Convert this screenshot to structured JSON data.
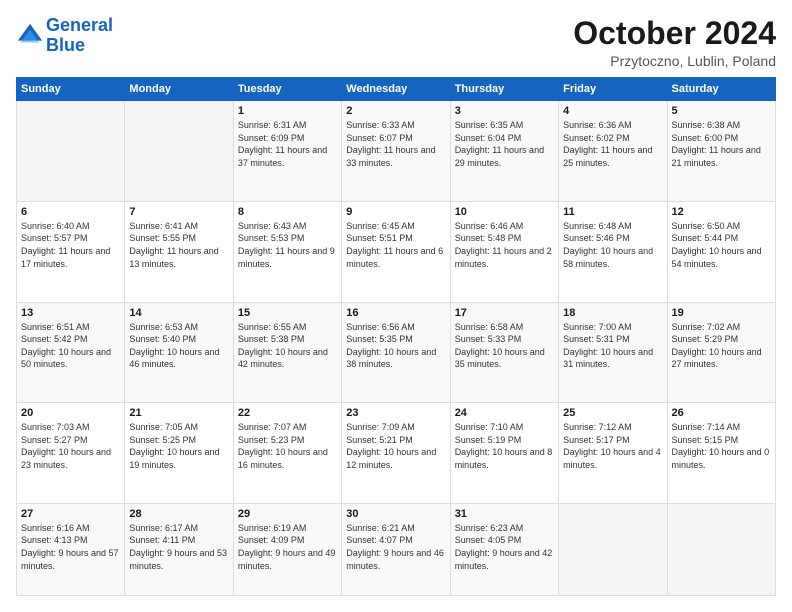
{
  "logo": {
    "line1": "General",
    "line2": "Blue"
  },
  "header": {
    "month": "October 2024",
    "location": "Przytoczno, Lublin, Poland"
  },
  "weekdays": [
    "Sunday",
    "Monday",
    "Tuesday",
    "Wednesday",
    "Thursday",
    "Friday",
    "Saturday"
  ],
  "weeks": [
    [
      {
        "day": "",
        "sunrise": "",
        "sunset": "",
        "daylight": ""
      },
      {
        "day": "",
        "sunrise": "",
        "sunset": "",
        "daylight": ""
      },
      {
        "day": "1",
        "sunrise": "Sunrise: 6:31 AM",
        "sunset": "Sunset: 6:09 PM",
        "daylight": "Daylight: 11 hours and 37 minutes."
      },
      {
        "day": "2",
        "sunrise": "Sunrise: 6:33 AM",
        "sunset": "Sunset: 6:07 PM",
        "daylight": "Daylight: 11 hours and 33 minutes."
      },
      {
        "day": "3",
        "sunrise": "Sunrise: 6:35 AM",
        "sunset": "Sunset: 6:04 PM",
        "daylight": "Daylight: 11 hours and 29 minutes."
      },
      {
        "day": "4",
        "sunrise": "Sunrise: 6:36 AM",
        "sunset": "Sunset: 6:02 PM",
        "daylight": "Daylight: 11 hours and 25 minutes."
      },
      {
        "day": "5",
        "sunrise": "Sunrise: 6:38 AM",
        "sunset": "Sunset: 6:00 PM",
        "daylight": "Daylight: 11 hours and 21 minutes."
      }
    ],
    [
      {
        "day": "6",
        "sunrise": "Sunrise: 6:40 AM",
        "sunset": "Sunset: 5:57 PM",
        "daylight": "Daylight: 11 hours and 17 minutes."
      },
      {
        "day": "7",
        "sunrise": "Sunrise: 6:41 AM",
        "sunset": "Sunset: 5:55 PM",
        "daylight": "Daylight: 11 hours and 13 minutes."
      },
      {
        "day": "8",
        "sunrise": "Sunrise: 6:43 AM",
        "sunset": "Sunset: 5:53 PM",
        "daylight": "Daylight: 11 hours and 9 minutes."
      },
      {
        "day": "9",
        "sunrise": "Sunrise: 6:45 AM",
        "sunset": "Sunset: 5:51 PM",
        "daylight": "Daylight: 11 hours and 6 minutes."
      },
      {
        "day": "10",
        "sunrise": "Sunrise: 6:46 AM",
        "sunset": "Sunset: 5:48 PM",
        "daylight": "Daylight: 11 hours and 2 minutes."
      },
      {
        "day": "11",
        "sunrise": "Sunrise: 6:48 AM",
        "sunset": "Sunset: 5:46 PM",
        "daylight": "Daylight: 10 hours and 58 minutes."
      },
      {
        "day": "12",
        "sunrise": "Sunrise: 6:50 AM",
        "sunset": "Sunset: 5:44 PM",
        "daylight": "Daylight: 10 hours and 54 minutes."
      }
    ],
    [
      {
        "day": "13",
        "sunrise": "Sunrise: 6:51 AM",
        "sunset": "Sunset: 5:42 PM",
        "daylight": "Daylight: 10 hours and 50 minutes."
      },
      {
        "day": "14",
        "sunrise": "Sunrise: 6:53 AM",
        "sunset": "Sunset: 5:40 PM",
        "daylight": "Daylight: 10 hours and 46 minutes."
      },
      {
        "day": "15",
        "sunrise": "Sunrise: 6:55 AM",
        "sunset": "Sunset: 5:38 PM",
        "daylight": "Daylight: 10 hours and 42 minutes."
      },
      {
        "day": "16",
        "sunrise": "Sunrise: 6:56 AM",
        "sunset": "Sunset: 5:35 PM",
        "daylight": "Daylight: 10 hours and 38 minutes."
      },
      {
        "day": "17",
        "sunrise": "Sunrise: 6:58 AM",
        "sunset": "Sunset: 5:33 PM",
        "daylight": "Daylight: 10 hours and 35 minutes."
      },
      {
        "day": "18",
        "sunrise": "Sunrise: 7:00 AM",
        "sunset": "Sunset: 5:31 PM",
        "daylight": "Daylight: 10 hours and 31 minutes."
      },
      {
        "day": "19",
        "sunrise": "Sunrise: 7:02 AM",
        "sunset": "Sunset: 5:29 PM",
        "daylight": "Daylight: 10 hours and 27 minutes."
      }
    ],
    [
      {
        "day": "20",
        "sunrise": "Sunrise: 7:03 AM",
        "sunset": "Sunset: 5:27 PM",
        "daylight": "Daylight: 10 hours and 23 minutes."
      },
      {
        "day": "21",
        "sunrise": "Sunrise: 7:05 AM",
        "sunset": "Sunset: 5:25 PM",
        "daylight": "Daylight: 10 hours and 19 minutes."
      },
      {
        "day": "22",
        "sunrise": "Sunrise: 7:07 AM",
        "sunset": "Sunset: 5:23 PM",
        "daylight": "Daylight: 10 hours and 16 minutes."
      },
      {
        "day": "23",
        "sunrise": "Sunrise: 7:09 AM",
        "sunset": "Sunset: 5:21 PM",
        "daylight": "Daylight: 10 hours and 12 minutes."
      },
      {
        "day": "24",
        "sunrise": "Sunrise: 7:10 AM",
        "sunset": "Sunset: 5:19 PM",
        "daylight": "Daylight: 10 hours and 8 minutes."
      },
      {
        "day": "25",
        "sunrise": "Sunrise: 7:12 AM",
        "sunset": "Sunset: 5:17 PM",
        "daylight": "Daylight: 10 hours and 4 minutes."
      },
      {
        "day": "26",
        "sunrise": "Sunrise: 7:14 AM",
        "sunset": "Sunset: 5:15 PM",
        "daylight": "Daylight: 10 hours and 0 minutes."
      }
    ],
    [
      {
        "day": "27",
        "sunrise": "Sunrise: 6:16 AM",
        "sunset": "Sunset: 4:13 PM",
        "daylight": "Daylight: 9 hours and 57 minutes."
      },
      {
        "day": "28",
        "sunrise": "Sunrise: 6:17 AM",
        "sunset": "Sunset: 4:11 PM",
        "daylight": "Daylight: 9 hours and 53 minutes."
      },
      {
        "day": "29",
        "sunrise": "Sunrise: 6:19 AM",
        "sunset": "Sunset: 4:09 PM",
        "daylight": "Daylight: 9 hours and 49 minutes."
      },
      {
        "day": "30",
        "sunrise": "Sunrise: 6:21 AM",
        "sunset": "Sunset: 4:07 PM",
        "daylight": "Daylight: 9 hours and 46 minutes."
      },
      {
        "day": "31",
        "sunrise": "Sunrise: 6:23 AM",
        "sunset": "Sunset: 4:05 PM",
        "daylight": "Daylight: 9 hours and 42 minutes."
      },
      {
        "day": "",
        "sunrise": "",
        "sunset": "",
        "daylight": ""
      },
      {
        "day": "",
        "sunrise": "",
        "sunset": "",
        "daylight": ""
      }
    ]
  ]
}
